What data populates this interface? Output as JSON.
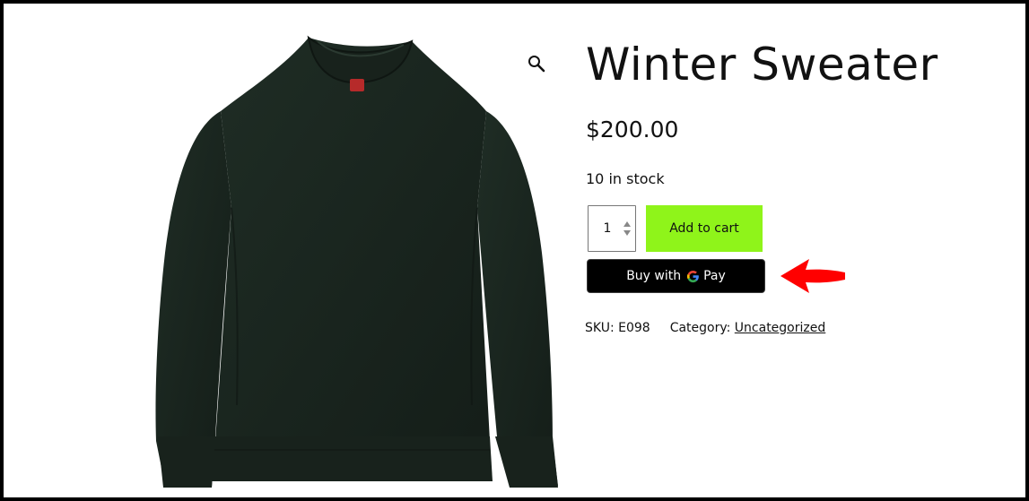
{
  "product": {
    "title": "Winter Sweater",
    "price": "$200.00",
    "stock": "10 in stock",
    "quantity": "1",
    "add_to_cart_label": "Add to cart",
    "gpay_prefix": "Buy with",
    "gpay_suffix": "Pay",
    "sku_label": "SKU:",
    "sku_value": "E098",
    "category_label": "Category:",
    "category_value": "Uncategorized"
  },
  "icons": {
    "zoom": "magnifier-icon",
    "quantity_spinner": "spinner-icon",
    "google": "google-g-icon",
    "annotation": "red-arrow-icon"
  },
  "colors": {
    "add_to_cart_bg": "#8ff41a",
    "gpay_bg": "#000000",
    "sweater": "#1c2a22",
    "arrow": "#ff0000"
  }
}
